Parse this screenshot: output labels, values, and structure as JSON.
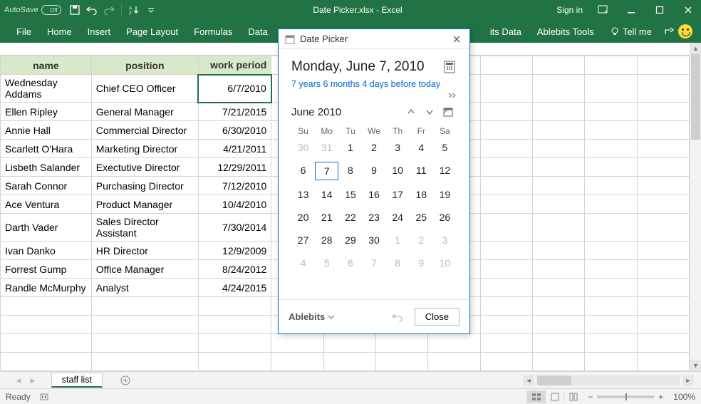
{
  "titlebar": {
    "autosave": "AutoSave",
    "autosave_state": "Off",
    "title": "Date Picker.xlsx  -  Excel",
    "signin": "Sign in"
  },
  "ribbon": {
    "tabs": [
      "File",
      "Home",
      "Insert",
      "Page Layout",
      "Formulas",
      "Data"
    ],
    "right_tabs": [
      "its Data",
      "Ablebits Tools"
    ],
    "tellme": "Tell me"
  },
  "headers": {
    "A": "name",
    "B": "position",
    "C": "work period"
  },
  "rows": [
    {
      "name": "Wednesday Addams",
      "position": "Chief CEO Officer",
      "period": "6/7/2010"
    },
    {
      "name": "Ellen Ripley",
      "position": "General Manager",
      "period": "7/21/2015"
    },
    {
      "name": "Annie Hall",
      "position": "Commercial Director",
      "period": "6/30/2010"
    },
    {
      "name": "Scarlett O'Hara",
      "position": "Marketing Director",
      "period": "4/21/2011"
    },
    {
      "name": "Lisbeth Salander",
      "position": "Exectutive Director",
      "period": "12/29/2011"
    },
    {
      "name": "Sarah Connor",
      "position": "Purchasing Director",
      "period": "7/12/2010"
    },
    {
      "name": "Ace Ventura",
      "position": "Product Manager",
      "period": "10/4/2010"
    },
    {
      "name": "Darth Vader",
      "position": "Sales Director Assistant",
      "period": "7/30/2014"
    },
    {
      "name": "Ivan Danko",
      "position": "HR Director",
      "period": "12/9/2009"
    },
    {
      "name": "Forrest Gump",
      "position": "Office Manager",
      "period": "8/24/2012"
    },
    {
      "name": "Randle McMurphy",
      "position": "Analyst",
      "period": "4/24/2015"
    }
  ],
  "datepicker": {
    "panel_title": "Date Picker",
    "bigdate": "Monday, June 7, 2010",
    "relative": "7 years 6 months 4 days before today",
    "month_label": "June 2010",
    "dow": [
      "Su",
      "Mo",
      "Tu",
      "We",
      "Th",
      "Fr",
      "Sa"
    ],
    "weeks": [
      [
        {
          "n": 30,
          "out": true
        },
        {
          "n": 31,
          "out": true
        },
        {
          "n": 1
        },
        {
          "n": 2
        },
        {
          "n": 3
        },
        {
          "n": 4
        },
        {
          "n": 5
        }
      ],
      [
        {
          "n": 6
        },
        {
          "n": 7,
          "sel": true
        },
        {
          "n": 8
        },
        {
          "n": 9
        },
        {
          "n": 10
        },
        {
          "n": 11
        },
        {
          "n": 12
        }
      ],
      [
        {
          "n": 13
        },
        {
          "n": 14
        },
        {
          "n": 15
        },
        {
          "n": 16
        },
        {
          "n": 17
        },
        {
          "n": 18
        },
        {
          "n": 19
        }
      ],
      [
        {
          "n": 20
        },
        {
          "n": 21
        },
        {
          "n": 22
        },
        {
          "n": 23
        },
        {
          "n": 24
        },
        {
          "n": 25
        },
        {
          "n": 26
        }
      ],
      [
        {
          "n": 27
        },
        {
          "n": 28
        },
        {
          "n": 29
        },
        {
          "n": 30
        },
        {
          "n": 1,
          "out": true
        },
        {
          "n": 2,
          "out": true
        },
        {
          "n": 3,
          "out": true
        }
      ],
      [
        {
          "n": 4,
          "out": true
        },
        {
          "n": 5,
          "out": true
        },
        {
          "n": 6,
          "out": true
        },
        {
          "n": 7,
          "out": true
        },
        {
          "n": 8,
          "out": true
        },
        {
          "n": 9,
          "out": true
        },
        {
          "n": 10,
          "out": true
        }
      ]
    ],
    "brand": "Ablebits",
    "close": "Close"
  },
  "sheettab": "staff list",
  "status": {
    "ready": "Ready",
    "zoom": "100%"
  }
}
